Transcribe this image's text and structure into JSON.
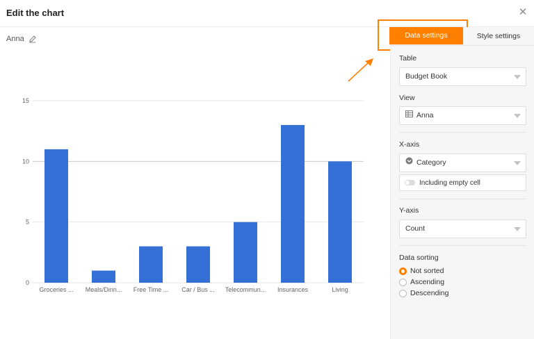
{
  "dialog": {
    "title": "Edit the chart",
    "close_glyph": "✕"
  },
  "chart_name": "Anna",
  "tabs": {
    "data_settings": "Data settings",
    "style_settings": "Style settings"
  },
  "settings": {
    "table_label": "Table",
    "table_value": "Budget Book",
    "view_label": "View",
    "view_value": "Anna",
    "xaxis_label": "X-axis",
    "xaxis_value": "Category",
    "empty_cell_label": "Including empty cell",
    "yaxis_label": "Y-axis",
    "yaxis_value": "Count",
    "sorting_label": "Data sorting",
    "sorting_options": [
      "Not sorted",
      "Ascending",
      "Descending"
    ],
    "sorting_selected": "Not sorted"
  },
  "colors": {
    "accent": "#ff8000",
    "bar": "#3470d6"
  },
  "icons": {
    "edit": "pencil-icon",
    "view": "table-grid-icon",
    "xaxis": "single-select-icon",
    "close": "close-icon"
  },
  "chart_data": {
    "type": "bar",
    "categories": [
      "Groceries ...",
      "Meals/Dinn...",
      "Free Time ...",
      "Car / Bus ...",
      "Telecommun...",
      "Insurances",
      "Living"
    ],
    "values": [
      11,
      1,
      3,
      3,
      5,
      13,
      10
    ],
    "yticks": [
      0,
      5,
      10,
      15
    ],
    "ylim": [
      0,
      15
    ],
    "grid": true
  }
}
